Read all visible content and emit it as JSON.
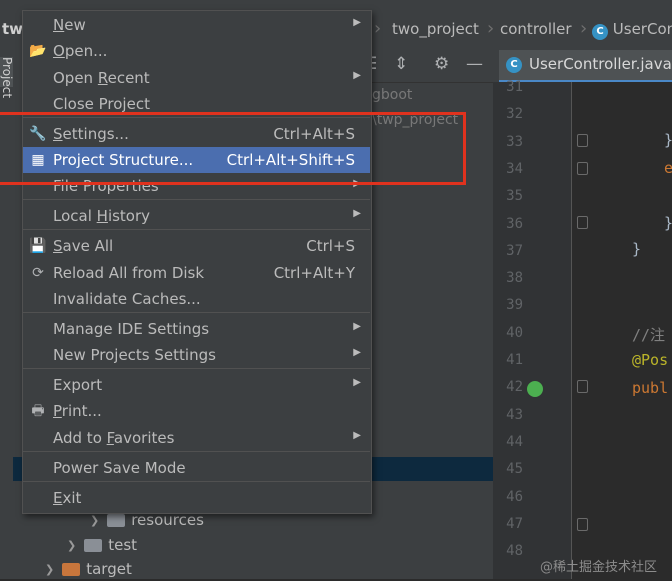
{
  "breadcrumb": {
    "root_partial": "twp",
    "items": [
      "two_project",
      "controller",
      "UserCon"
    ]
  },
  "stripe": {
    "project_label": "Project"
  },
  "project_panel": {
    "ghost_texts": [
      "gboot",
      "\\twp_project"
    ],
    "tree": [
      {
        "label": "resources",
        "expanded": false
      },
      {
        "label": "test",
        "expanded": false
      },
      {
        "label": "target",
        "expanded": false
      }
    ]
  },
  "editor": {
    "tab_label": "UserController.java",
    "tab_icon_letter": "C",
    "line_numbers": [
      31,
      32,
      33,
      34,
      35,
      36,
      37,
      38,
      39,
      40,
      41,
      42,
      43,
      44,
      45,
      46,
      47,
      48
    ],
    "code_fragments": {
      "l33": "}",
      "l34": "e",
      "l36": "}",
      "l37": "}",
      "l40": "//注",
      "l41": "@Pos",
      "l42": "publ"
    }
  },
  "file_menu": {
    "items": [
      {
        "label": "New",
        "mnemonic": "N",
        "rest": "ew",
        "shortcut": "",
        "submenu": true,
        "icon": ""
      },
      {
        "label": "Open...",
        "mnemonic": "O",
        "rest": "pen...",
        "shortcut": "",
        "submenu": false,
        "icon": "folder-open-icon"
      },
      {
        "label_pre": "Open ",
        "mnemonic": "R",
        "rest": "ecent",
        "shortcut": "",
        "submenu": true
      },
      {
        "label": "Close Project",
        "shortcut": "",
        "submenu": false
      },
      {
        "label": "Settings...",
        "mnemonic": "S",
        "rest": "ettings...",
        "shortcut": "Ctrl+Alt+S",
        "submenu": false,
        "icon": "wrench-icon"
      },
      {
        "label": "Project Structure...",
        "shortcut": "Ctrl+Alt+Shift+S",
        "submenu": false,
        "icon": "project-structure-icon",
        "highlighted": true
      },
      {
        "label": "File Properties",
        "shortcut": "",
        "submenu": true
      },
      {
        "label_pre": "Local ",
        "mnemonic": "H",
        "rest": "istory",
        "shortcut": "",
        "submenu": true
      },
      {
        "label": "Save All",
        "mnemonic": "S",
        "rest": "ave All",
        "shortcut": "Ctrl+S",
        "submenu": false,
        "icon": "save-icon"
      },
      {
        "label": "Reload All from Disk",
        "shortcut": "Ctrl+Alt+Y",
        "submenu": false,
        "icon": "reload-icon"
      },
      {
        "label": "Invalidate Caches...",
        "shortcut": "",
        "submenu": false
      },
      {
        "label": "Manage IDE Settings",
        "shortcut": "",
        "submenu": true
      },
      {
        "label": "New Projects Settings",
        "shortcut": "",
        "submenu": true
      },
      {
        "label": "Export",
        "shortcut": "",
        "submenu": true
      },
      {
        "label": "Print...",
        "mnemonic": "P",
        "rest": "rint...",
        "shortcut": "",
        "submenu": false,
        "icon": "print-icon"
      },
      {
        "label_pre": "Add to ",
        "mnemonic": "F",
        "rest": "avorites",
        "shortcut": "",
        "submenu": true
      },
      {
        "label": "Power Save Mode",
        "shortcut": "",
        "submenu": false
      },
      {
        "label": "Exit",
        "mnemonic": "E",
        "rest": "xit",
        "shortcut": "",
        "submenu": false
      }
    ]
  },
  "watermark": "@稀土掘金技术社区",
  "colors": {
    "menu_bg": "#3c3f41",
    "highlight": "#4b6eaf",
    "annotation_red": "#e0321e",
    "editor_bg": "#2b2b2b",
    "accent_blue": "#3592c4",
    "annotation_yellow": "#bbb529"
  }
}
